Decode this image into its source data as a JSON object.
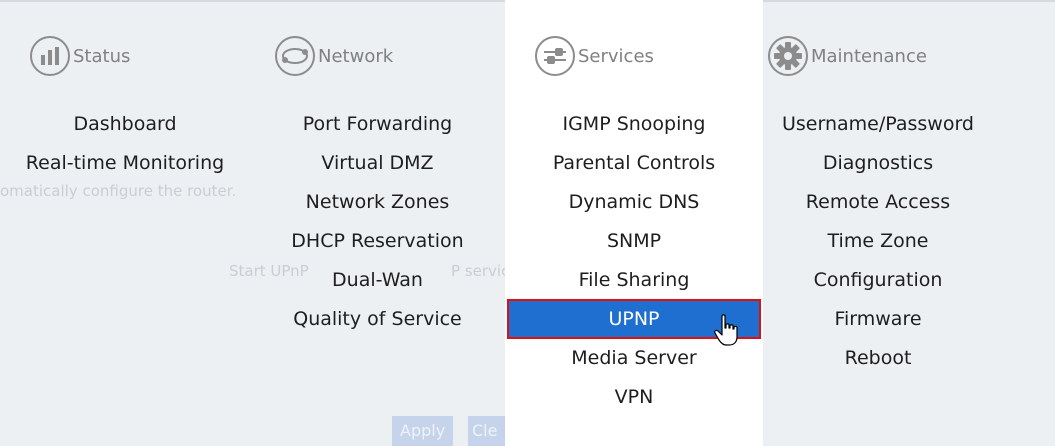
{
  "background": {
    "description_line": "omatically configure the router.",
    "upnp_label_start": "Start UPnP",
    "upnp_label_end": "P service",
    "apply_button": "Apply",
    "clear_button": "Cle"
  },
  "menu": {
    "columns": [
      {
        "title": "Status",
        "icon": "bar-chart-icon",
        "items": [
          "Dashboard",
          "Real-time Monitoring"
        ]
      },
      {
        "title": "Network",
        "icon": "network-link-icon",
        "items": [
          "Port Forwarding",
          "Virtual DMZ",
          "Network Zones",
          "DHCP Reservation",
          "Dual-Wan",
          "Quality of Service"
        ]
      },
      {
        "title": "Services",
        "icon": "sliders-icon",
        "items": [
          "IGMP Snooping",
          "Parental Controls",
          "Dynamic DNS",
          "SNMP",
          "File Sharing",
          "UPNP",
          "Media Server",
          "VPN"
        ],
        "selected_item": "UPNP"
      },
      {
        "title": "Maintenance",
        "icon": "gear-icon",
        "items": [
          "Username/Password",
          "Diagnostics",
          "Remote Access",
          "Time Zone",
          "Configuration",
          "Firmware",
          "Reboot"
        ]
      }
    ]
  },
  "colors": {
    "highlight": "#1f6fd0",
    "highlight_border": "#e01010",
    "icon_gray": "#8c8c8c"
  }
}
